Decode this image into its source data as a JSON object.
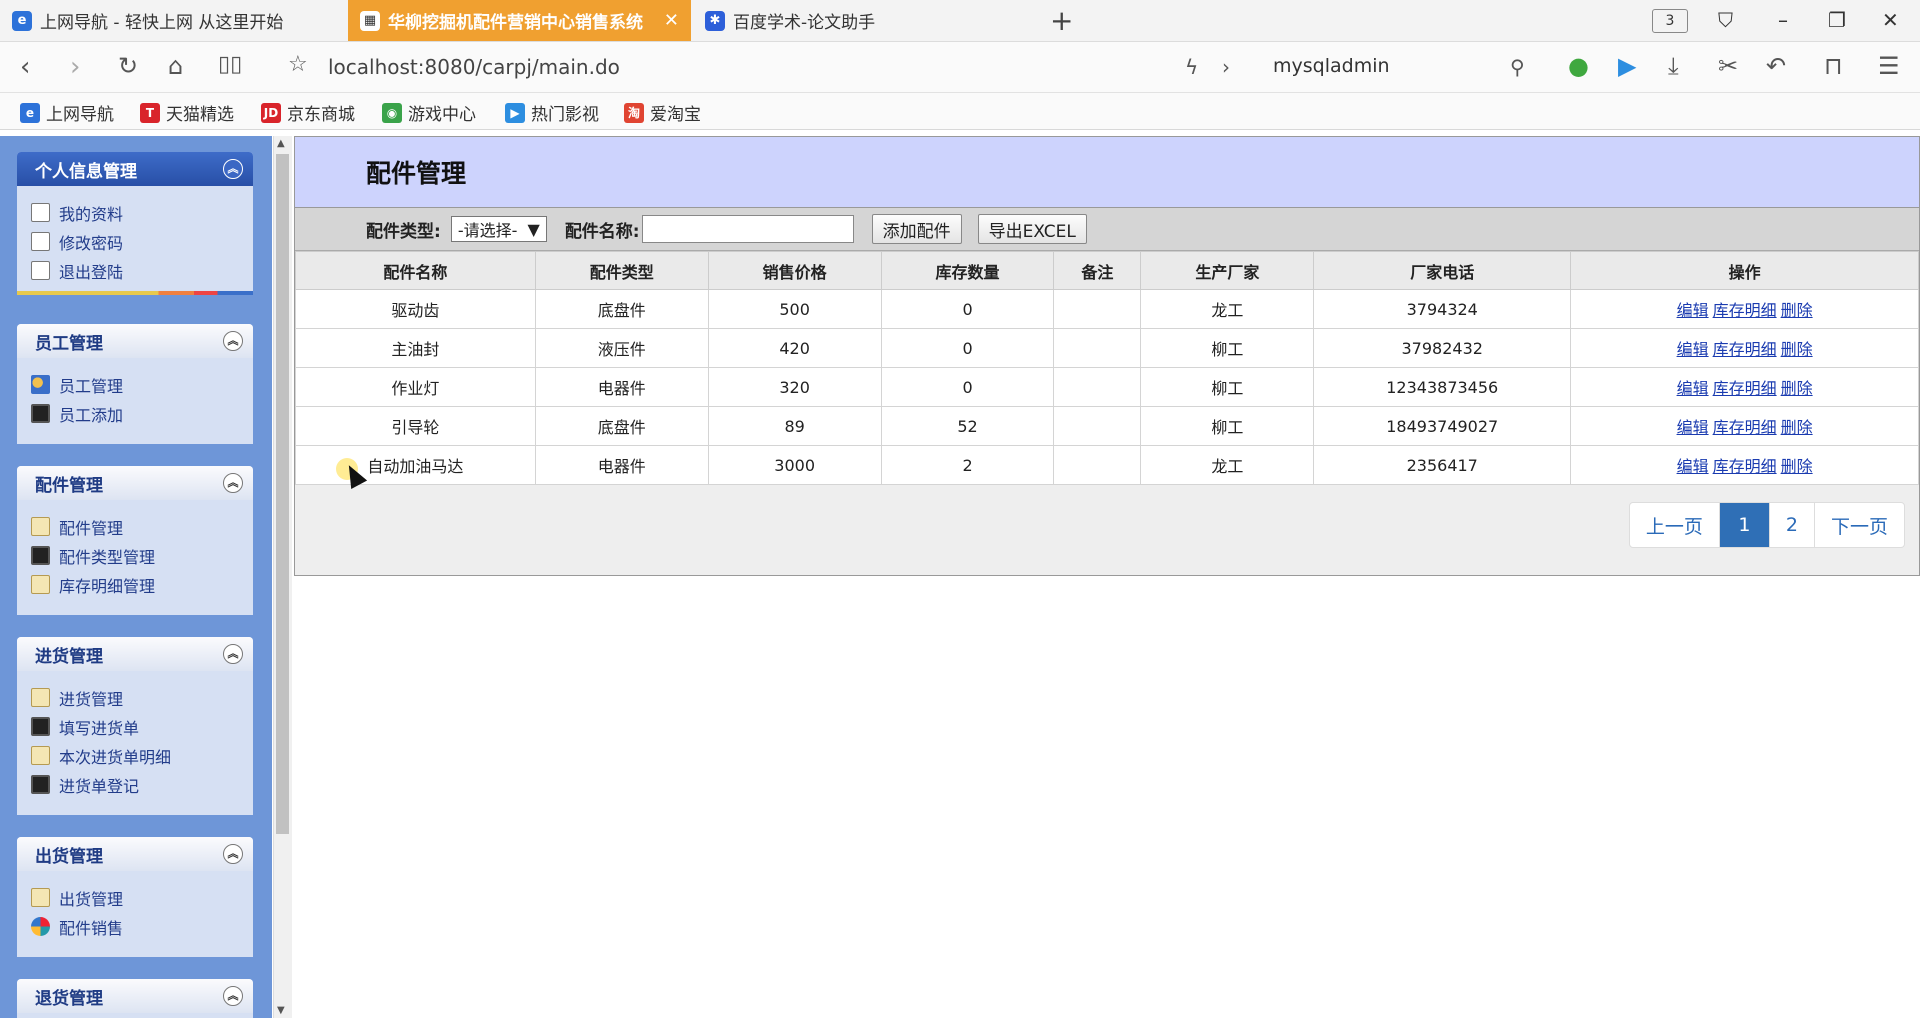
{
  "tabs": [
    {
      "title": "上网导航 - 轻快上网 从这里开始",
      "icon": "ie-icon",
      "color": "#2d72d9"
    },
    {
      "title": "华柳挖掘机配件营销中心销售系统",
      "icon": "page-icon",
      "color": "#f0a030"
    },
    {
      "title": "百度学术-论文助手",
      "icon": "paw-icon",
      "color": "#2d5fd9"
    }
  ],
  "tab_count": "3",
  "address": {
    "url": "localhost:8080/carpj/main.do",
    "search": "mysqladmin"
  },
  "bookmarks": [
    {
      "label": "上网导航",
      "badge": "e",
      "color": "#2d72d9"
    },
    {
      "label": "天猫精选",
      "badge": "T",
      "color": "#d9242b"
    },
    {
      "label": "京东商城",
      "badge": "JD",
      "color": "#d9242b"
    },
    {
      "label": "游戏中心",
      "badge": "",
      "color": "#3aa34a"
    },
    {
      "label": "热门影视",
      "badge": "",
      "color": "#2d8ee0"
    },
    {
      "label": "爱淘宝",
      "badge": "淘",
      "color": "#e04432"
    }
  ],
  "sidebar": [
    {
      "title": "个人信息管理",
      "items": [
        {
          "label": "我的资料",
          "icon": "doc"
        },
        {
          "label": "修改密码",
          "icon": "doc"
        },
        {
          "label": "退出登陆",
          "icon": "doc"
        }
      ]
    },
    {
      "title": "员工管理",
      "items": [
        {
          "label": "员工管理",
          "icon": "users"
        },
        {
          "label": "员工添加",
          "icon": "floppy"
        }
      ]
    },
    {
      "title": "配件管理",
      "items": [
        {
          "label": "配件管理",
          "icon": "clip"
        },
        {
          "label": "配件类型管理",
          "icon": "floppy"
        },
        {
          "label": "库存明细管理",
          "icon": "clip"
        }
      ]
    },
    {
      "title": "进货管理",
      "items": [
        {
          "label": "进货管理",
          "icon": "clip"
        },
        {
          "label": "填写进货单",
          "icon": "floppy"
        },
        {
          "label": "本次进货单明细",
          "icon": "clip"
        },
        {
          "label": "进货单登记",
          "icon": "floppy"
        }
      ]
    },
    {
      "title": "出货管理",
      "items": [
        {
          "label": "出货管理",
          "icon": "clip"
        },
        {
          "label": "配件销售",
          "icon": "globe"
        }
      ]
    },
    {
      "title": "退货管理",
      "items": []
    }
  ],
  "page": {
    "title": "配件管理",
    "filter_type_label": "配件类型:",
    "filter_type_value": "-请选择-",
    "filter_name_label": "配件名称:",
    "filter_name_value": "",
    "add_button": "添加配件",
    "export_button": "导出EXCEL"
  },
  "table": {
    "headers": [
      "配件名称",
      "配件类型",
      "销售价格",
      "库存数量",
      "备注",
      "生产厂家",
      "厂家电话",
      "操作"
    ],
    "rows": [
      [
        "驱动齿",
        "底盘件",
        "500",
        "0",
        "",
        "龙工",
        "3794324"
      ],
      [
        "主油封",
        "液压件",
        "420",
        "0",
        "",
        "柳工",
        "37982432"
      ],
      [
        "作业灯",
        "电器件",
        "320",
        "0",
        "",
        "柳工",
        "12343873456"
      ],
      [
        "引导轮",
        "底盘件",
        "89",
        "52",
        "",
        "柳工",
        "18493749027"
      ],
      [
        "自动加油马达",
        "电器件",
        "3000",
        "2",
        "",
        "龙工",
        "2356417"
      ]
    ],
    "ops": [
      "编辑",
      "库存明细",
      "删除"
    ]
  },
  "pager": {
    "prev": "上一页",
    "pages": [
      "1",
      "2"
    ],
    "current": "1",
    "next": "下一页"
  }
}
